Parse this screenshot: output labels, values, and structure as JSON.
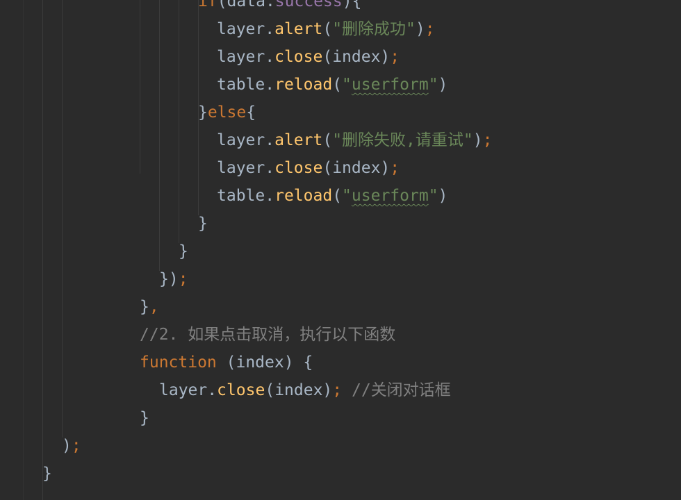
{
  "editor": {
    "theme_colors": {
      "background": "#2b2b2b",
      "default_text": "#a9b7c6",
      "keyword": "#cc7832",
      "method": "#ffc66d",
      "field": "#9876aa",
      "string": "#6a8759",
      "comment": "#808080",
      "typo_underline": "#6a8759"
    },
    "lines": [
      [
        {
          "t": "if",
          "c": "kw"
        },
        {
          "t": "(data.",
          "c": "plain"
        },
        {
          "t": "success",
          "c": "field"
        },
        {
          "t": "){",
          "c": "plain"
        }
      ],
      [
        {
          "t": "layer.",
          "c": "plain"
        },
        {
          "t": "alert",
          "c": "method"
        },
        {
          "t": "(",
          "c": "plain"
        },
        {
          "t": "\"删除成功\"",
          "c": "str"
        },
        {
          "t": ")",
          "c": "plain"
        },
        {
          "t": ";",
          "c": "semi"
        }
      ],
      [
        {
          "t": "layer.",
          "c": "plain"
        },
        {
          "t": "close",
          "c": "method"
        },
        {
          "t": "(index)",
          "c": "plain"
        },
        {
          "t": ";",
          "c": "semi"
        }
      ],
      [
        {
          "t": "table.",
          "c": "plain"
        },
        {
          "t": "reload",
          "c": "method"
        },
        {
          "t": "(",
          "c": "plain"
        },
        {
          "t": "\"",
          "c": "str"
        },
        {
          "t": "userform",
          "c": "str",
          "typo": true
        },
        {
          "t": "\"",
          "c": "str"
        },
        {
          "t": ")",
          "c": "plain"
        }
      ],
      [
        {
          "t": "}",
          "c": "plain"
        },
        {
          "t": "else",
          "c": "kw"
        },
        {
          "t": "{",
          "c": "plain"
        }
      ],
      [
        {
          "t": "layer.",
          "c": "plain"
        },
        {
          "t": "alert",
          "c": "method"
        },
        {
          "t": "(",
          "c": "plain"
        },
        {
          "t": "\"删除失败,请重试\"",
          "c": "str"
        },
        {
          "t": ")",
          "c": "plain"
        },
        {
          "t": ";",
          "c": "semi"
        }
      ],
      [
        {
          "t": "layer.",
          "c": "plain"
        },
        {
          "t": "close",
          "c": "method"
        },
        {
          "t": "(index)",
          "c": "plain"
        },
        {
          "t": ";",
          "c": "semi"
        }
      ],
      [
        {
          "t": "table.",
          "c": "plain"
        },
        {
          "t": "reload",
          "c": "method"
        },
        {
          "t": "(",
          "c": "plain"
        },
        {
          "t": "\"",
          "c": "str"
        },
        {
          "t": "userform",
          "c": "str",
          "typo": true
        },
        {
          "t": "\"",
          "c": "str"
        },
        {
          "t": ")",
          "c": "plain"
        }
      ],
      [
        {
          "t": "}",
          "c": "plain"
        }
      ],
      [
        {
          "t": "}",
          "c": "plain"
        }
      ],
      [
        {
          "t": "})",
          "c": "plain"
        },
        {
          "t": ";",
          "c": "semi"
        }
      ],
      [
        {
          "t": "}",
          "c": "plain"
        },
        {
          "t": ",",
          "c": "semi"
        }
      ],
      [
        {
          "t": "//2. 如果点击取消，执行以下函数",
          "c": "comment"
        }
      ],
      [
        {
          "t": "function",
          "c": "kw"
        },
        {
          "t": " (index) {",
          "c": "plain"
        }
      ],
      [
        {
          "t": "layer.",
          "c": "plain"
        },
        {
          "t": "close",
          "c": "method"
        },
        {
          "t": "(index)",
          "c": "plain"
        },
        {
          "t": "; ",
          "c": "semi"
        },
        {
          "t": "//关闭对话框",
          "c": "comment"
        }
      ],
      [
        {
          "t": "}",
          "c": "plain"
        }
      ],
      [
        {
          "t": ")",
          "c": "plain"
        },
        {
          "t": ";",
          "c": "semi"
        }
      ],
      [
        {
          "t": "}",
          "c": "plain"
        }
      ]
    ]
  }
}
